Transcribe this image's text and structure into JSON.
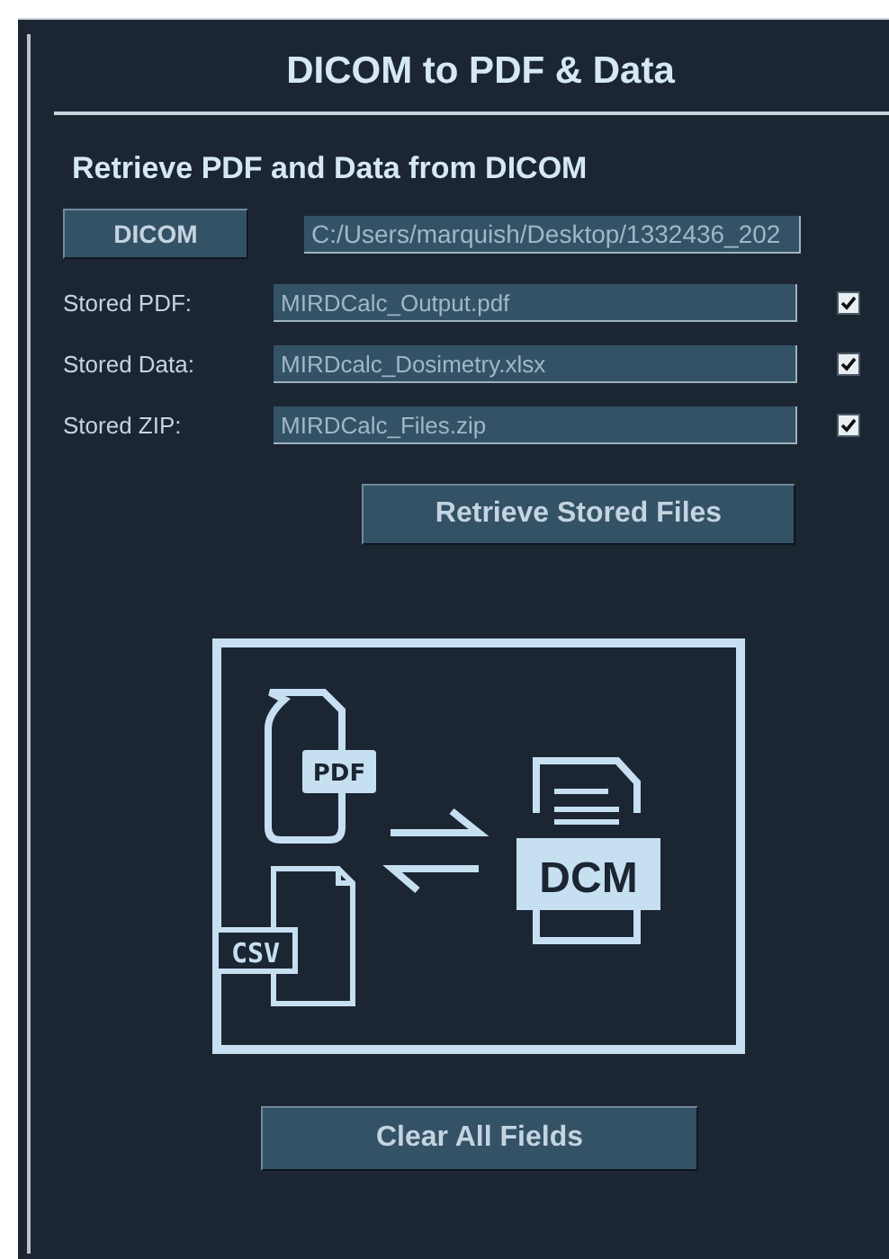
{
  "title": "DICOM to PDF & Data",
  "section": {
    "heading": "Retrieve PDF and Data from DICOM"
  },
  "dicom_button": "DICOM",
  "dicom_path": "C:/Users/marquish/Desktop/1332436_202",
  "stored_files": [
    {
      "label": "Stored PDF:",
      "value": "MIRDCalc_Output.pdf",
      "checked": true
    },
    {
      "label": "Stored Data:",
      "value": "MIRDcalc_Dosimetry.xlsx",
      "checked": true
    },
    {
      "label": "Stored ZIP:",
      "value": "MIRDCalc_Files.zip",
      "checked": true
    }
  ],
  "retrieve_button": "Retrieve Stored Files",
  "illustration": {
    "pdf_label": "PDF",
    "csv_label": "CSV",
    "dcm_label": "DCM"
  },
  "clear_button": "Clear All Fields"
}
